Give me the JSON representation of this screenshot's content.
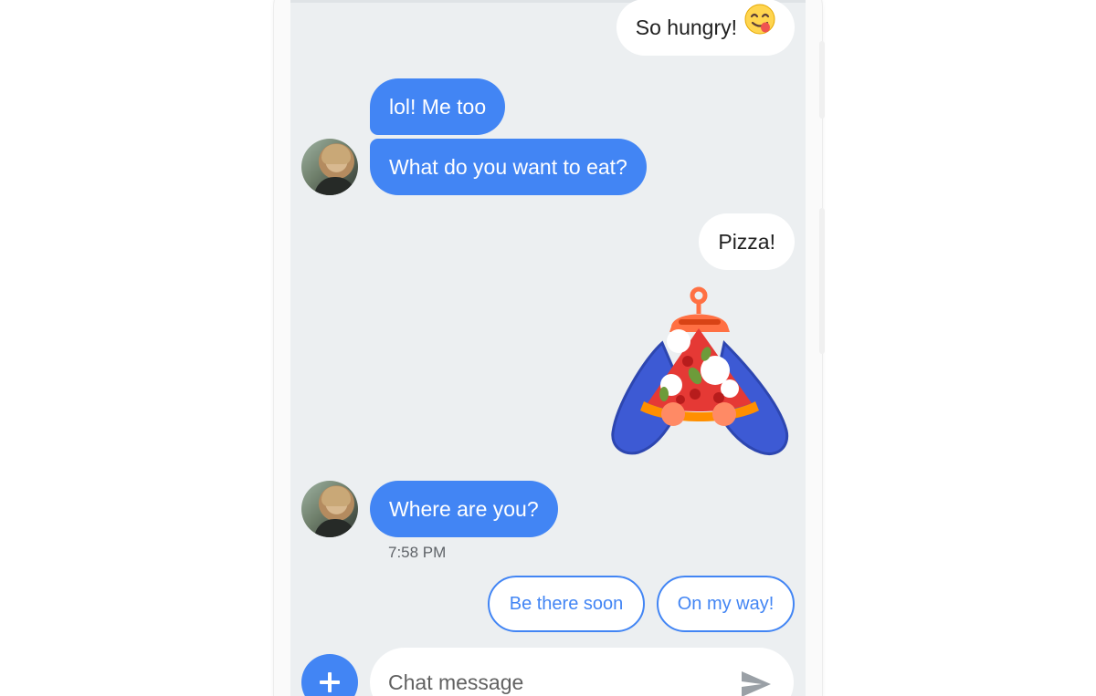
{
  "colors": {
    "accent": "#4285f4",
    "screen_background": "#eceff1",
    "outgoing_bubble": "#ffffff",
    "send_icon": "#9aa0a6"
  },
  "conversation": {
    "messages": [
      {
        "direction": "outgoing",
        "text": "So hungry!",
        "emoji": "face-savoring-food-emoji"
      },
      {
        "direction": "incoming",
        "text": "lol! Me too"
      },
      {
        "direction": "incoming",
        "text": "What do you want to eat?"
      },
      {
        "direction": "outgoing",
        "text": "Pizza!"
      },
      {
        "direction": "outgoing",
        "sticker": "pizza-slice-sticker"
      },
      {
        "direction": "incoming",
        "text": "Where are you?"
      }
    ],
    "timestamp": "7:58 PM"
  },
  "smart_replies": [
    "Be there soon",
    "On my way!"
  ],
  "compose": {
    "placeholder": "Chat message",
    "add_icon": "plus-icon",
    "send_icon": "send-icon"
  }
}
